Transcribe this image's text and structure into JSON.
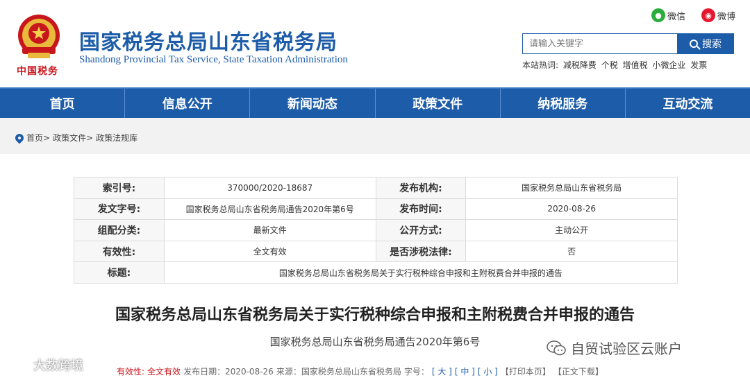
{
  "header": {
    "emblem_text": "中国税务",
    "title": "国家税务总局山东省税务局",
    "subtitle": "Shandong Provincial Tax Service, State Taxation Administration",
    "wechat_label": "微信",
    "weibo_label": "微博",
    "search_placeholder": "请输入关键字",
    "search_button": "搜索",
    "hot_label": "本站热词:",
    "hot_words": [
      "减税降费",
      "个税",
      "增值税",
      "小微企业",
      "发票"
    ]
  },
  "nav": [
    "首页",
    "信息公开",
    "新闻动态",
    "政策文件",
    "纳税服务",
    "互动交流"
  ],
  "breadcrumb": [
    "首页>",
    "政策文件>",
    "政策法规库"
  ],
  "meta": {
    "index_label": "索引号:",
    "index_value": "370000/2020-18687",
    "issuer_label": "发布机构:",
    "issuer_value": "国家税务总局山东省税务局",
    "docno_label": "发文字号:",
    "docno_value": "国家税务总局山东省税务局通告2020年第6号",
    "date_label": "发布时间:",
    "date_value": "2020-08-26",
    "category_label": "组配分类:",
    "category_value": "最新文件",
    "open_label": "公开方式:",
    "open_value": "主动公开",
    "validity_label": "有效性:",
    "validity_value": "全文有效",
    "taxlaw_label": "是否涉税法律:",
    "taxlaw_value": "否",
    "title_label": "标题:",
    "title_value": "国家税务总局山东省税务局关于实行税种综合申报和主附税费合并申报的通告"
  },
  "document": {
    "title": "国家税务总局山东省税务局关于实行税种综合申报和主附税费合并申报的通告",
    "number": "国家税务总局山东省税务局通告2020年第6号"
  },
  "info": {
    "validity_label": "有效性:",
    "validity_value": "全文有效",
    "date_text": "发布日期：2020-08-26",
    "source_text": "来源：国家税务总局山东省税务局",
    "fontsize_label": "字号：",
    "font_large": "[ 大 ]",
    "font_medium": "[ 中 ]",
    "font_small": "[ 小 ]",
    "print": "【打印本页】",
    "download": "【正文下载】"
  },
  "watermarks": {
    "account": "自贸试验区云账户",
    "brand": "大数跨境"
  },
  "colors": {
    "brand_blue": "#1d5ca8",
    "emblem_red": "#c8161d",
    "wechat_green": "#2aae3b",
    "weibo_red": "#e6162d"
  }
}
